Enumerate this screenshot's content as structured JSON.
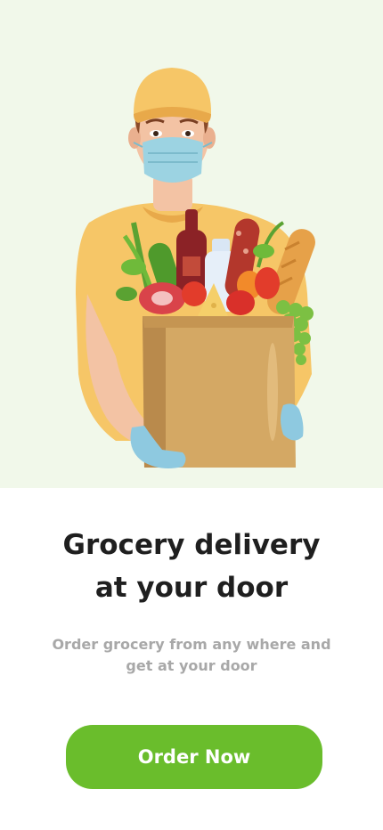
{
  "hero": {
    "background_color": "#f1f8ea",
    "illustration": "delivery-person-with-grocery-bag"
  },
  "headline": {
    "line1": "Grocery delivery",
    "line2": "at your door"
  },
  "description": {
    "line1": "Order grocery from any where and",
    "line2": "get at your door"
  },
  "cta": {
    "label": "Order Now",
    "color": "#6abd2c"
  }
}
